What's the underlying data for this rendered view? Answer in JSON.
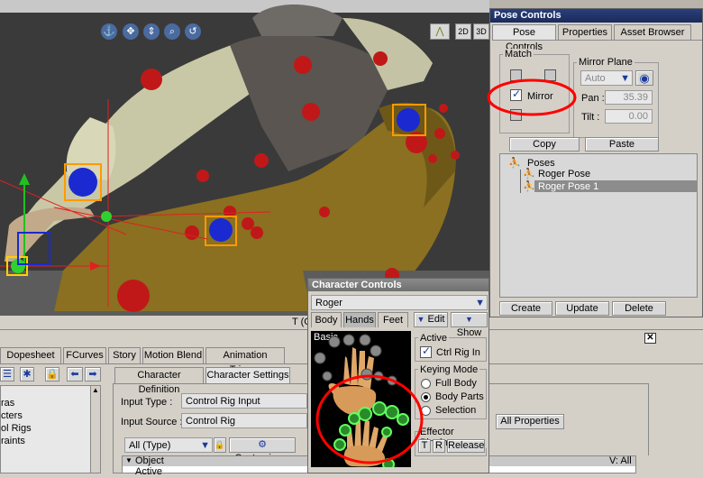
{
  "viewport": {
    "nav_icons": [
      "anchor-icon",
      "move-icon",
      "vertical-arrows-icon",
      "zoom-icon",
      "undo-circle-icon"
    ],
    "right_icons": [
      "curve-icon",
      "2d-icon",
      "3d-icon"
    ],
    "status_text": "T (G"
  },
  "pose_controls": {
    "title": "Pose Controls",
    "tabs": [
      "Pose Controls",
      "Properties",
      "Asset Browser"
    ],
    "match_label": "Match",
    "mirror_plane_label": "Mirror Plane",
    "mirror_plane_value": "Auto",
    "mirror_label": "Mirror",
    "pan_label": "Pan :",
    "pan_value": "35.39",
    "tilt_label": "Tilt :",
    "tilt_value": "0.00",
    "copy_label": "Copy",
    "paste_label": "Paste",
    "poses_root": "Poses",
    "poses": [
      "Roger Pose",
      "Roger Pose 1"
    ],
    "create_label": "Create",
    "update_label": "Update",
    "delete_label": "Delete"
  },
  "character_controls": {
    "title": "Character Controls",
    "character": "Roger",
    "tabs": [
      "Body",
      "Hands",
      "Feet"
    ],
    "edit_label": "Edit",
    "show_label": "Show",
    "basic_label": "Basic",
    "active_label": "Active",
    "ctrl_rig_in_label": "Ctrl Rig In",
    "keying_mode_label": "Keying Mode",
    "keying_options": [
      "Full Body",
      "Body Parts",
      "Selection"
    ],
    "effector_pinning_label": "Effector Pinning",
    "pin_t": "T",
    "pin_r": "R",
    "release_label": "Release"
  },
  "bottom_panel": {
    "tabs": [
      "Dopesheet",
      "FCurves",
      "Story",
      "Motion Blend",
      "Animation Trigger"
    ],
    "sub_tabs": [
      "Character Definition",
      "Character Settings"
    ],
    "tree_items": [
      "ras",
      "cters",
      "ol Rigs",
      "raints"
    ],
    "input_type_label": "Input Type :",
    "input_type_value": "Control Rig Input",
    "input_source_label": "Input Source :",
    "input_source_value": "Control Rig",
    "filter_value": "All (Type)",
    "customize_label": "Customize...",
    "all_properties_label": "All Properties",
    "object_label": "Object",
    "active_row": "Active",
    "v_all": "V: All"
  },
  "colors": {
    "titlebar": "#1a2a5a",
    "annotation_red": "#ff0000",
    "selected_row": "#8c8c8c"
  }
}
